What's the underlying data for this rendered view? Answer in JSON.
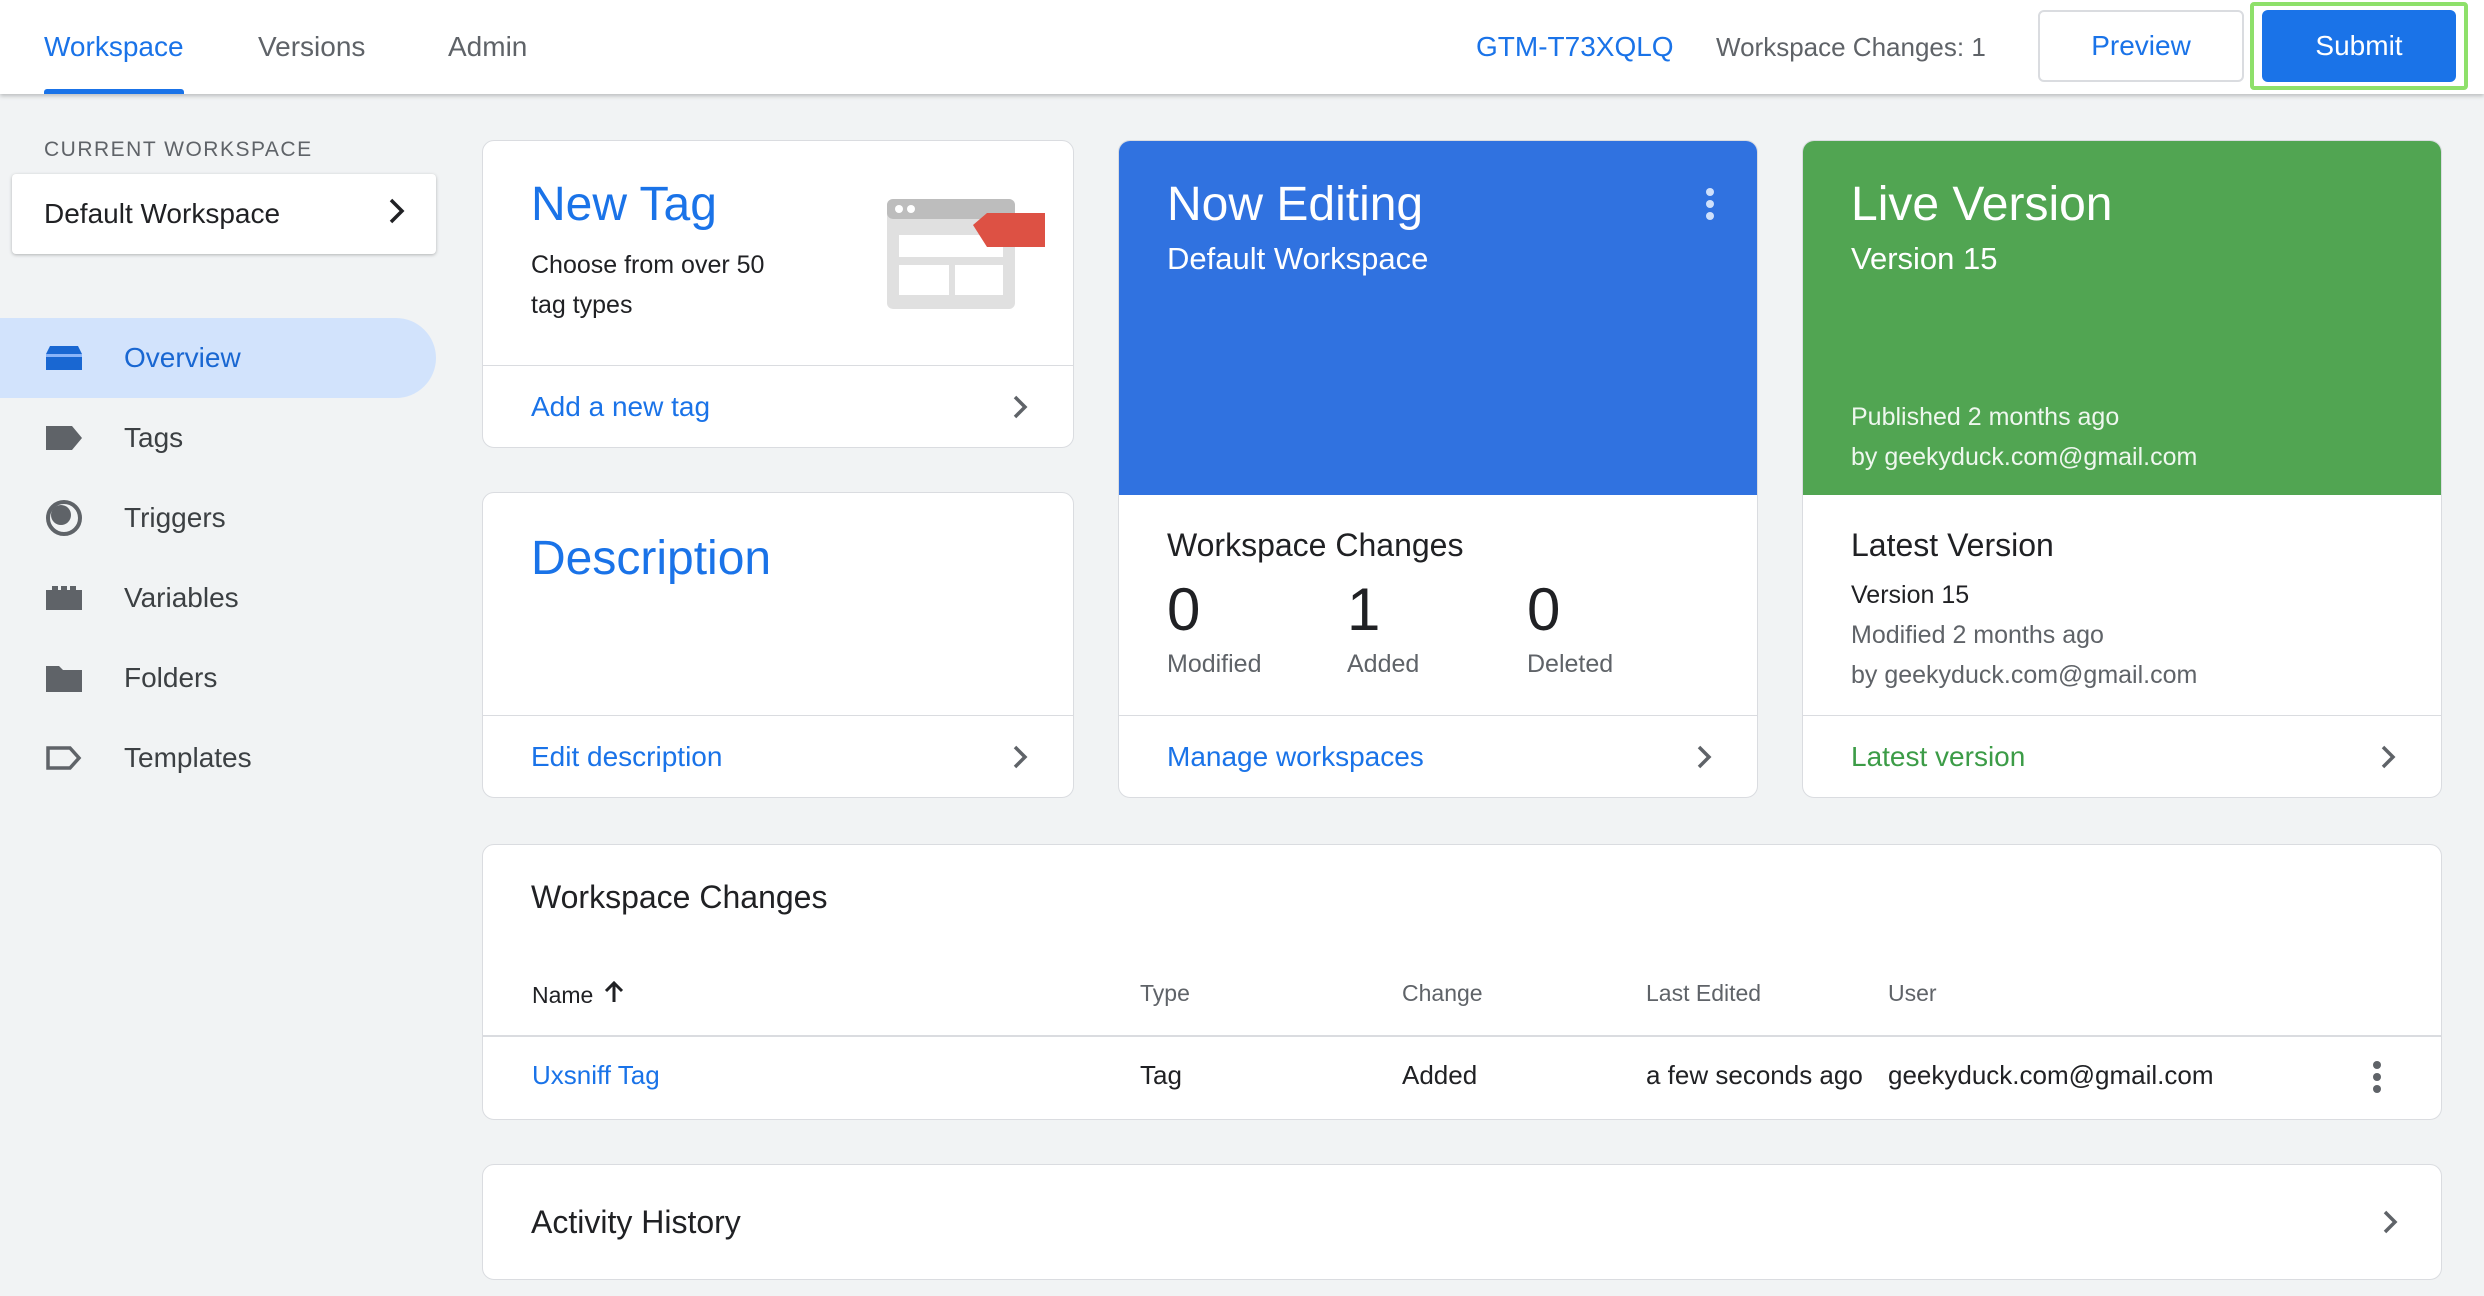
{
  "topbar": {
    "tabs": [
      {
        "label": "Workspace",
        "active": true
      },
      {
        "label": "Versions",
        "active": false
      },
      {
        "label": "Admin",
        "active": false
      }
    ],
    "container_id": "GTM-T73XQLQ",
    "workspace_changes": "Workspace Changes: 1",
    "preview_label": "Preview",
    "submit_label": "Submit"
  },
  "sidebar": {
    "current_workspace_label": "CURRENT WORKSPACE",
    "workspace_name": "Default Workspace",
    "items": [
      {
        "label": "Overview",
        "icon": "overview-icon",
        "active": true
      },
      {
        "label": "Tags",
        "icon": "tag-icon",
        "active": false
      },
      {
        "label": "Triggers",
        "icon": "trigger-icon",
        "active": false
      },
      {
        "label": "Variables",
        "icon": "variables-icon",
        "active": false
      },
      {
        "label": "Folders",
        "icon": "folder-icon",
        "active": false
      },
      {
        "label": "Templates",
        "icon": "template-icon",
        "active": false
      }
    ]
  },
  "new_tag_card": {
    "title": "New Tag",
    "subtitle_line1": "Choose from over 50",
    "subtitle_line2": "tag types",
    "footer_link": "Add a new tag"
  },
  "description_card": {
    "title": "Description",
    "footer_link": "Edit description"
  },
  "now_editing_card": {
    "title": "Now Editing",
    "subtitle": "Default Workspace",
    "header_color": "#3072e0",
    "changes_title": "Workspace Changes",
    "stats": [
      {
        "value": "0",
        "label": "Modified"
      },
      {
        "value": "1",
        "label": "Added"
      },
      {
        "value": "0",
        "label": "Deleted"
      }
    ],
    "footer_link": "Manage workspaces"
  },
  "live_version_card": {
    "title": "Live Version",
    "subtitle": "Version 15",
    "published": "Published 2 months ago",
    "published_by": "by geekyduck.com@gmail.com",
    "header_color": "#51a552",
    "latest_title": "Latest Version",
    "latest_version": "Version 15",
    "latest_modified": "Modified 2 months ago",
    "latest_by": "by geekyduck.com@gmail.com",
    "footer_link": "Latest version"
  },
  "changes_table": {
    "title": "Workspace Changes",
    "columns": [
      "Name",
      "Type",
      "Change",
      "Last Edited",
      "User"
    ],
    "rows": [
      {
        "name": "Uxsniff Tag",
        "type": "Tag",
        "change": "Added",
        "last_edited": "a few seconds ago",
        "user": "geekyduck.com@gmail.com"
      }
    ]
  },
  "activity_history": {
    "title": "Activity History"
  }
}
